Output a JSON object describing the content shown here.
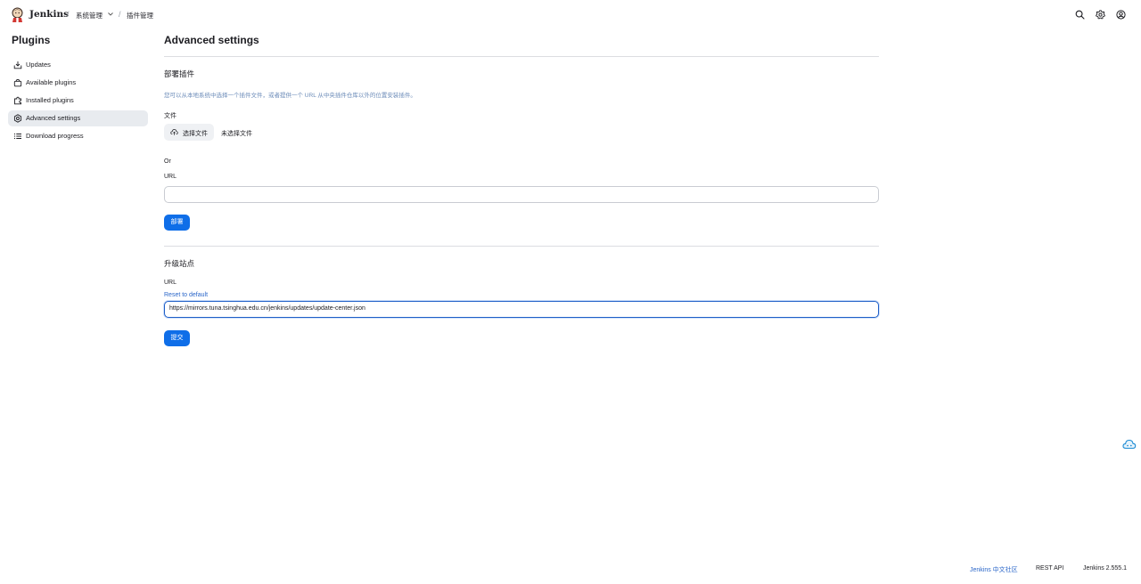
{
  "header": {
    "brand": "Jenkins",
    "breadcrumbs": [
      "系统管理",
      "插件管理"
    ],
    "separator": "/",
    "icons": [
      "search-icon",
      "gear-icon",
      "user-icon"
    ]
  },
  "sidebar": {
    "title": "Plugins",
    "items": [
      {
        "label": "Updates",
        "icon": "download-icon"
      },
      {
        "label": "Available plugins",
        "icon": "bag-icon"
      },
      {
        "label": "Installed plugins",
        "icon": "puzzle-icon"
      },
      {
        "label": "Advanced settings",
        "icon": "gear-icon",
        "active": true
      },
      {
        "label": "Download progress",
        "icon": "list-icon"
      }
    ]
  },
  "main": {
    "title": "Advanced settings",
    "deploy": {
      "title": "部署插件",
      "description": "您可以从本地系统中选择一个插件文件，或者提供一个 URL 从中央插件仓库以外的位置安装插件。",
      "file_label": "文件",
      "file_button": "选择文件",
      "file_none": "未选择文件",
      "or_label": "Or",
      "url_label": "URL",
      "url_value": "",
      "submit": "部署"
    },
    "update_site": {
      "title": "升级站点",
      "url_label": "URL",
      "reset_link": "Reset to default",
      "url_value": "https://mirrors.tuna.tsinghua.edu.cn/jenkins/updates/update-center.json",
      "submit": "提交"
    }
  },
  "footer": {
    "community": "Jenkins 中文社区",
    "rest_api": "REST API",
    "version": "Jenkins 2.555.1"
  },
  "colors": {
    "accent": "#0f6ee8",
    "link": "#2a66c9",
    "active_bg": "#e8ebef"
  }
}
